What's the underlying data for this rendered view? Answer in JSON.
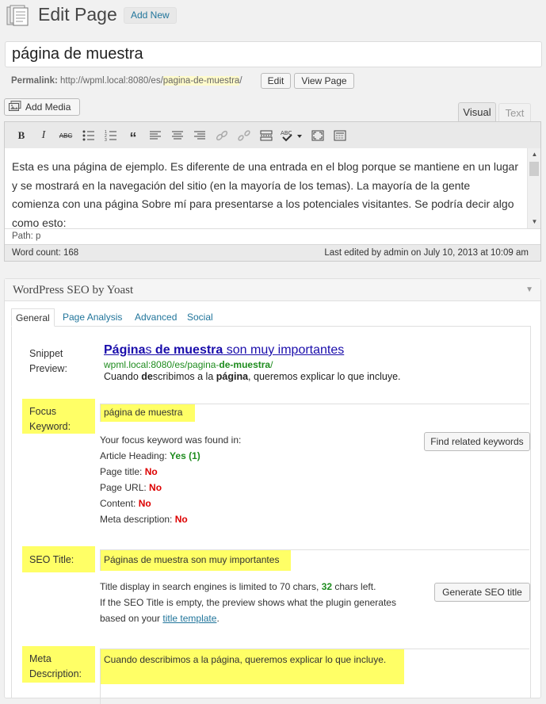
{
  "header": {
    "title": "Edit Page",
    "add_new": "Add New"
  },
  "post_title": "página de muestra",
  "permalink": {
    "label": "Permalink:",
    "base": "http://wpml.local:8080/es/",
    "slug": "pagina-de-muestra",
    "trailing": "/",
    "edit": "Edit",
    "view": "View Page"
  },
  "media": {
    "add_media": "Add Media"
  },
  "editor_tabs": {
    "visual": "Visual",
    "text": "Text"
  },
  "toolbar": [
    "bold-button",
    "italic-button",
    "strikethrough-button",
    "bullet-list-button",
    "numbered-list-button",
    "blockquote-button",
    "align-left-button",
    "align-center-button",
    "align-right-button",
    "insert-link-button",
    "unlink-button",
    "insert-more-button",
    "spellcheck-button",
    "fullscreen-button",
    "kitchen-sink-button"
  ],
  "editor": {
    "content": "Esta es una página de ejemplo. Es diferente de una entrada en el blog porque se mantiene en un lugar y se mostrará en la navegación del sitio (en la mayoría de los temas). La mayoría de la gente comienza con una página Sobre mí para presentarse a los potenciales visitantes. Se podría decir algo como esto:",
    "path": "Path: p",
    "word_count": "Word count: 168",
    "last_edited": "Last edited by admin on July 10, 2013 at 10:09 am"
  },
  "seo": {
    "box_title": "WordPress SEO by Yoast",
    "tabs": [
      "General",
      "Page Analysis",
      "Advanced",
      "Social"
    ],
    "snippet": {
      "label_line1": "Snippet",
      "label_line2": "Preview:",
      "title_bold1": "Página",
      "title_part2": "s ",
      "title_bold2": "de muestra",
      "title_part3": " son muy importantes",
      "url_part1": "wpml.local:8080/es/pagina-",
      "url_bold": "de-muestra",
      "url_part2": "/",
      "desc_part1": "Cuando ",
      "desc_bold1": "de",
      "desc_part2": "scribimos a la ",
      "desc_bold2": "página",
      "desc_part3": ", queremos explicar lo que incluye."
    },
    "focus": {
      "label_line1": "Focus",
      "label_line2": "Keyword:",
      "value": "página de muestra",
      "found_in": "Your focus keyword was found in:",
      "checks": [
        {
          "label": "Article Heading: ",
          "result": "Yes (1)",
          "ok": true
        },
        {
          "label": "Page title: ",
          "result": "No",
          "ok": false
        },
        {
          "label": "Page URL: ",
          "result": "No",
          "ok": false
        },
        {
          "label": "Content: ",
          "result": "No",
          "ok": false
        },
        {
          "label": "Meta description: ",
          "result": "No",
          "ok": false
        }
      ],
      "related_button": "Find related keywords"
    },
    "seo_title": {
      "label": "SEO Title:",
      "value": "Páginas de muestra son muy importantes",
      "info1_a": "Title display in search engines is limited to 70 chars, ",
      "info1_count": "32",
      "info1_b": " chars left.",
      "info2": "If the SEO Title is empty, the preview shows what the plugin generates",
      "info3_a": "based on your ",
      "info3_link": "title template",
      "info3_b": ".",
      "generate_button": "Generate SEO title"
    },
    "meta": {
      "label_line1": "Meta",
      "label_line2": "Description:",
      "value": "Cuando describimos a la página, queremos explicar lo que incluye."
    }
  },
  "colors": {
    "link": "#21759b",
    "highlight": "#ffff66",
    "yes": "#1e8c1e",
    "no": "#dd0000"
  }
}
